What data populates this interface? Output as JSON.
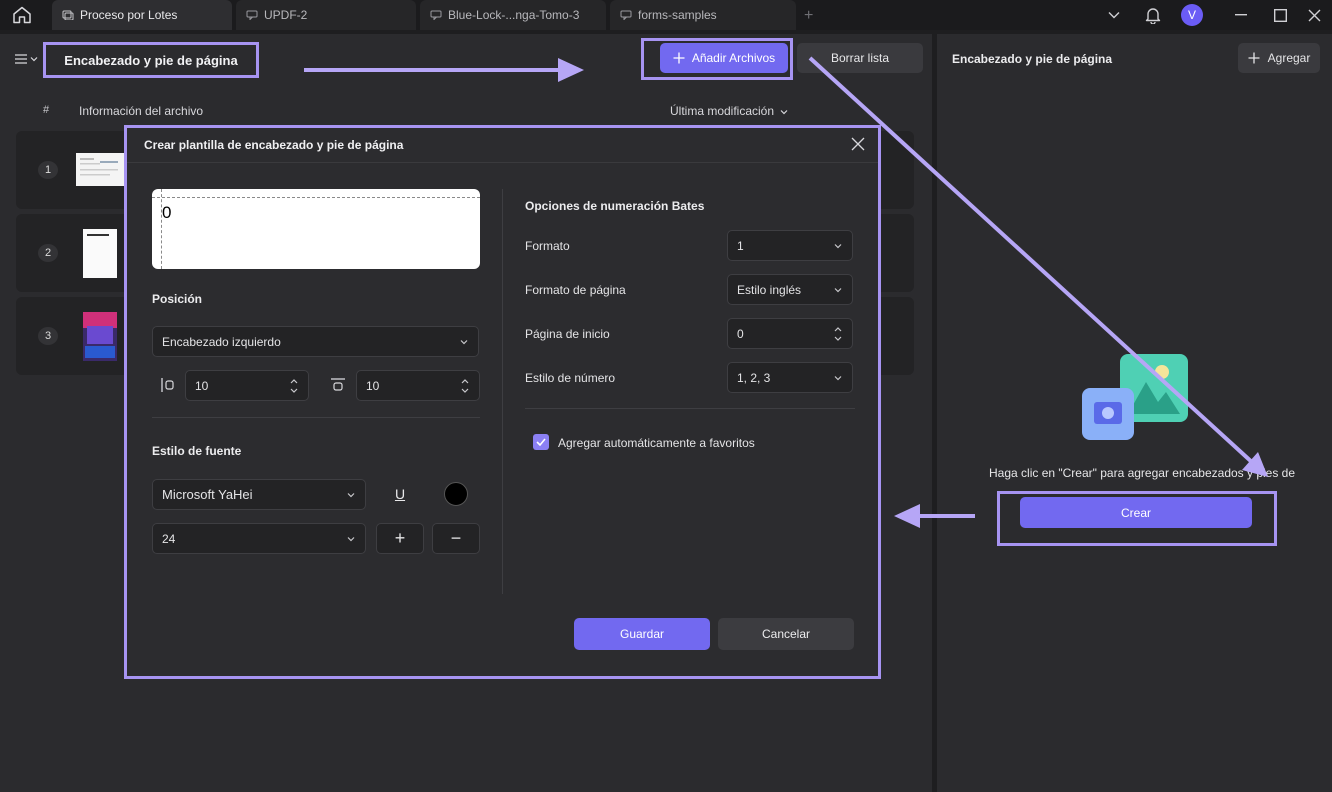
{
  "titlebar": {
    "tabs": [
      {
        "label": "Proceso por Lotes",
        "icon": "batch-icon"
      },
      {
        "label": "UPDF-2",
        "icon": "chat-icon"
      },
      {
        "label": "Blue-Lock-...nga-Tomo-3",
        "icon": "chat-icon"
      },
      {
        "label": "forms-samples",
        "icon": "chat-icon"
      }
    ],
    "new_tab": "+",
    "avatar_initial": "V"
  },
  "main": {
    "page_title": "Encabezado y pie de página",
    "add_files_label": "Añadir Archivos",
    "clear_list_label": "Borrar lista",
    "columns": {
      "number": "#",
      "info": "Información del archivo",
      "modified": "Última modificación"
    },
    "rows": [
      {
        "num": "1"
      },
      {
        "num": "2"
      },
      {
        "num": "3"
      }
    ]
  },
  "right_panel": {
    "title": "Encabezado y pie de página",
    "add_label": "Agregar",
    "hint": "Haga clic en \"Crear\" para agregar encabezados y pies de",
    "create_label": "Crear"
  },
  "dialog": {
    "title": "Crear plantilla de encabezado y pie de página",
    "preview_text": "0",
    "position_label": "Posición",
    "position_value": "Encabezado izquierdo",
    "margin_left": "10",
    "margin_top": "10",
    "font_style_label": "Estilo de fuente",
    "font_family": "Microsoft YaHei",
    "font_size": "24",
    "underline_glyph": "U",
    "font_color": "#000000",
    "increase_glyph": "+",
    "decrease_glyph": "−",
    "bates": {
      "heading": "Opciones de numeración Bates",
      "format_label": "Formato",
      "format_value": "1",
      "page_format_label": "Formato de página",
      "page_format_value": "Estilo inglés",
      "start_page_label": "Página de inicio",
      "start_page_value": "0",
      "number_style_label": "Estilo de número",
      "number_style_value": "1, 2, 3"
    },
    "favorites_label": "Agregar automáticamente a favoritos",
    "favorites_checked": true,
    "save_label": "Guardar",
    "cancel_label": "Cancelar"
  },
  "colors": {
    "accent": "#7269f0",
    "highlight": "#a794f2",
    "panel": "#2b2b2e",
    "background": "#1e1e20"
  }
}
